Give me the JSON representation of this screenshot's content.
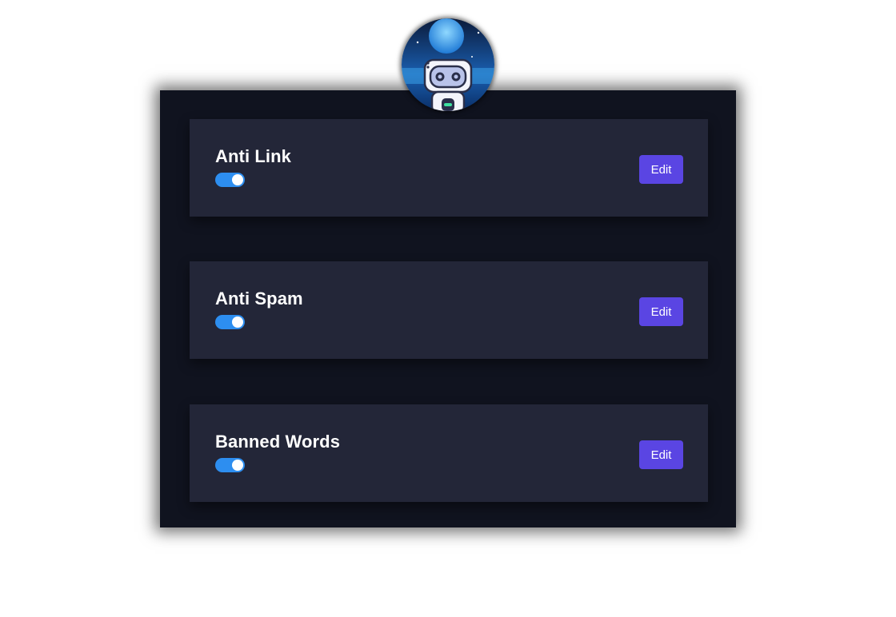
{
  "avatar": {
    "icon": "robot-astronaut-icon"
  },
  "settings": [
    {
      "title": "Anti Link",
      "enabled": true,
      "edit_label": "Edit"
    },
    {
      "title": "Anti Spam",
      "enabled": true,
      "edit_label": "Edit"
    },
    {
      "title": "Banned Words",
      "enabled": true,
      "edit_label": "Edit"
    }
  ],
  "colors": {
    "panel_bg": "#10131f",
    "card_bg": "#232638",
    "toggle_on": "#2d8ef0",
    "button_bg": "#5a45e3",
    "text": "#ffffff"
  }
}
